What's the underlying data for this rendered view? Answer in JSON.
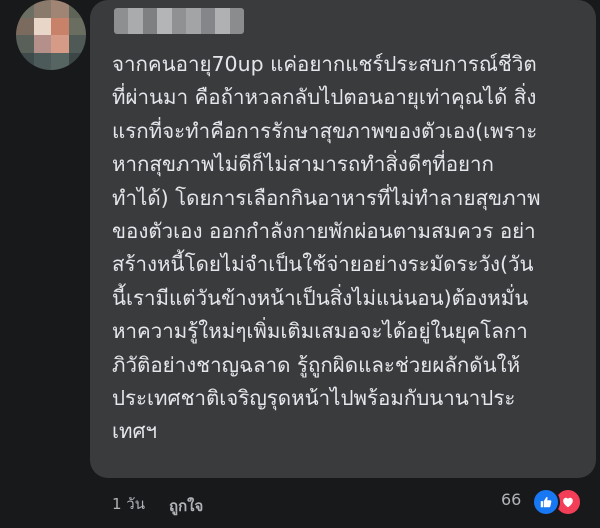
{
  "comment": {
    "lines": [
      "จากคนอายุ70up แค่อยากแชร์ประสบการณ์ชีวิต",
      "ที่ผ่านมา คือถ้าหวลกลับไปตอนอายุเท่าคุณได้ สิ่ง",
      "แรกที่จะทำคือการรักษาสุขภาพของตัวเอง(เพราะ",
      "หากสุขภาพไม่ดีก็ไม่สามารถทำสิ่งดีๆที่อยาก",
      "ทำได้) โดยการเลือกกินอาหารที่ไม่ทำลายสุขภาพ",
      "ของตัวเอง ออกกำลังกายพักผ่อนตามสมควร อย่า",
      "สร้างหนี้โดยไม่จำเป็นใช้จ่ายอย่างระมัดระวัง(วัน",
      "นี้เรามีแต่วันข้างหน้าเป็นสิ่งไม่แน่นอน)ต้องหมั่น",
      "หาความรู้ใหม่ๆเพิ่มเติมเสมอจะได้อยู่ในยุคโลกา",
      "ภิวัติอย่างชาญฉลาด รู้ถูกผิดและช่วยผลักดันให้",
      "ประเทศชาติเจริญรุดหน้าไปพร้อมกับนานาประ",
      "เทศฯ"
    ]
  },
  "footer": {
    "timestamp": "1 วัน",
    "like_label": "ถูกใจ",
    "reaction_count": "66",
    "reactions": [
      "like-icon",
      "love-icon"
    ]
  },
  "colors": {
    "background": "#18191a",
    "bubble": "#3a3b3c",
    "text": "#e4e6eb",
    "secondary_text": "#b0b3b8",
    "like_blue": "#1877f2",
    "love_red": "#f33e58"
  }
}
